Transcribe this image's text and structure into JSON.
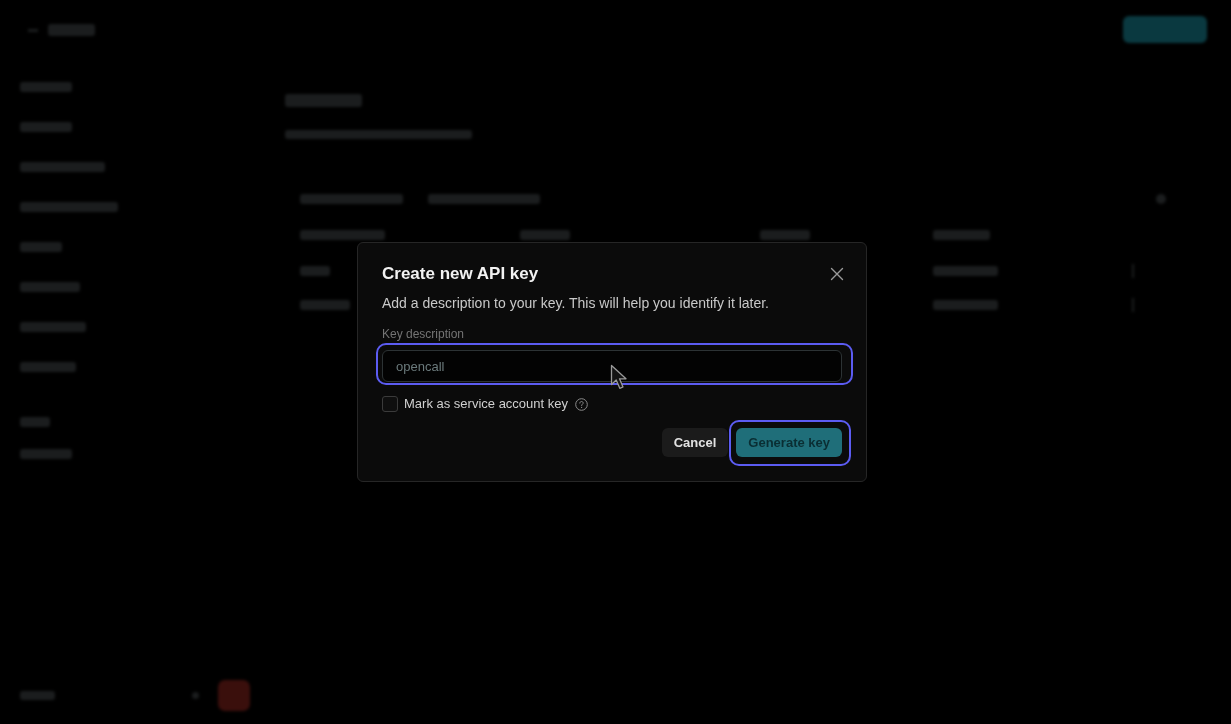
{
  "dialog": {
    "title": "Create new API key",
    "description": "Add a description to your key. This will help you identify it later.",
    "field": {
      "label": "Key description",
      "placeholder": "opencall",
      "highlighted": true
    },
    "checkbox": {
      "label": "Mark as service account key",
      "checked": false
    },
    "buttons": [
      {
        "label": "Cancel",
        "kind": "secondary",
        "highlighted": false
      },
      {
        "label": "Generate key",
        "kind": "primary",
        "highlighted": true
      }
    ]
  }
}
